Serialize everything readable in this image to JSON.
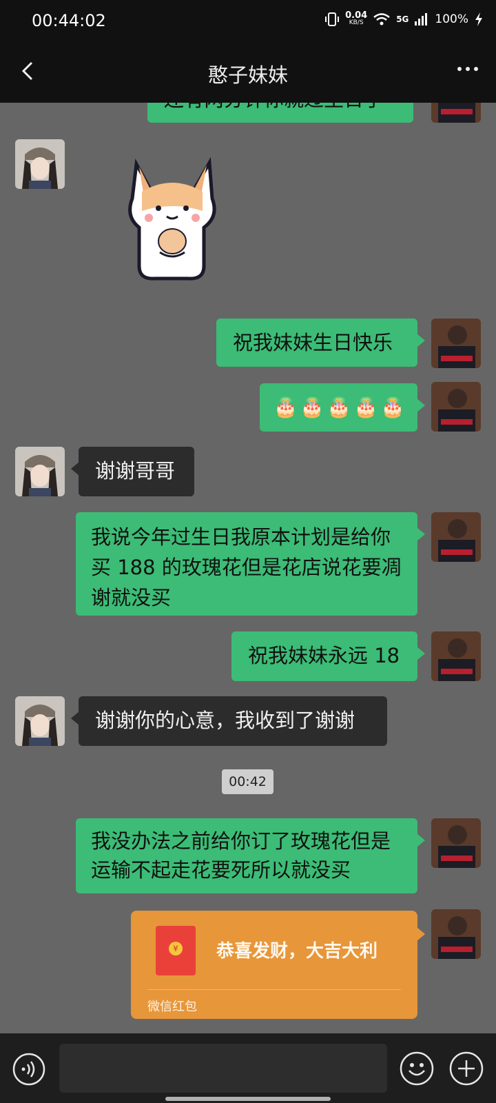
{
  "status_bar": {
    "time": "00:44:02",
    "net_speed_value": "0.04",
    "net_speed_unit": "KB/S",
    "network": "5G",
    "battery": "100%"
  },
  "header": {
    "title": "憨子妹妹"
  },
  "messages": [
    {
      "side": "right",
      "type": "text",
      "text": "还有两分钟你就过生日了"
    },
    {
      "side": "left",
      "type": "sticker",
      "sticker": "corgi-holding-hamster"
    },
    {
      "side": "right",
      "type": "text",
      "text": "祝我妹妹生日快乐"
    },
    {
      "side": "right",
      "type": "emoji",
      "emojis": [
        "🎂",
        "🎂",
        "🎂",
        "🎂",
        "🎂"
      ]
    },
    {
      "side": "left",
      "type": "text",
      "text": "谢谢哥哥"
    },
    {
      "side": "right",
      "type": "text",
      "text": "我说今年过生日我原本计划是给你买 188 的玫瑰花但是花店说花要凋谢就没买"
    },
    {
      "side": "right",
      "type": "text",
      "text": "祝我妹妹永远 18"
    },
    {
      "side": "left",
      "type": "text",
      "text": "谢谢你的心意，我收到了谢谢"
    },
    {
      "side": "right",
      "type": "text",
      "text": "我没办法之前给你订了玫瑰花但是运输不起走花要死所以就没买"
    },
    {
      "side": "right",
      "type": "red_packet",
      "title": "恭喜发财，大吉大利",
      "label": "微信红包"
    }
  ],
  "timestamp": "00:42",
  "colors": {
    "chat_bg": "#666666",
    "outgoing_bubble": "#3cbc76",
    "incoming_bubble": "#2c2c2c",
    "red_packet": "#e7963a"
  },
  "icons": {
    "back": "chevron-left-icon",
    "more": "more-dots-icon",
    "voice": "voice-icon",
    "emoji": "emoji-icon",
    "plus": "plus-icon"
  }
}
